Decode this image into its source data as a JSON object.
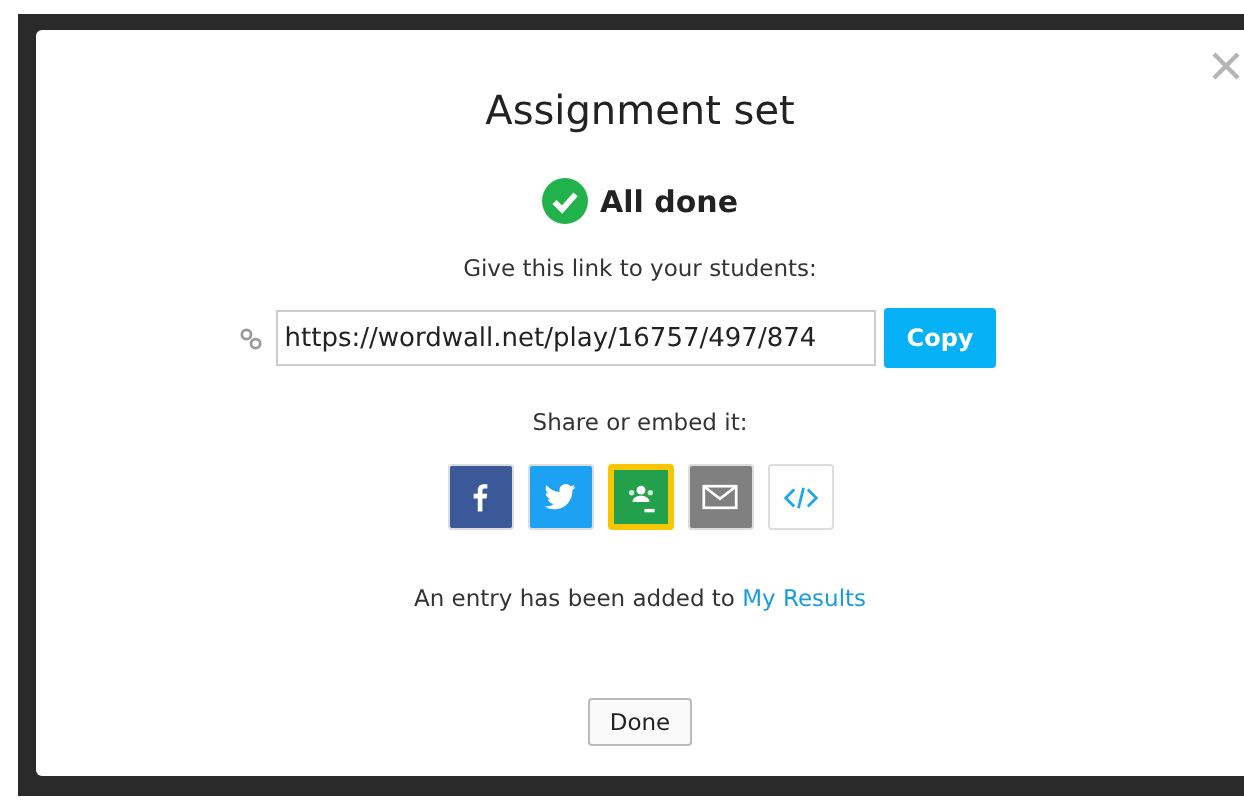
{
  "dialog": {
    "title": "Assignment set",
    "status": "All done",
    "instruction": "Give this link to your students:",
    "link": {
      "value": "https://wordwall.net/play/16757/497/874",
      "copy_button": "Copy"
    },
    "share_label": "Share or embed it:",
    "share_buttons": [
      {
        "kind": "facebook",
        "selected": false
      },
      {
        "kind": "twitter",
        "selected": false
      },
      {
        "kind": "classroom",
        "selected": true
      },
      {
        "kind": "email",
        "selected": false
      },
      {
        "kind": "embed",
        "selected": false
      }
    ],
    "note": "An entry has been added to",
    "note_link": "My Results",
    "done_button": "Done"
  }
}
